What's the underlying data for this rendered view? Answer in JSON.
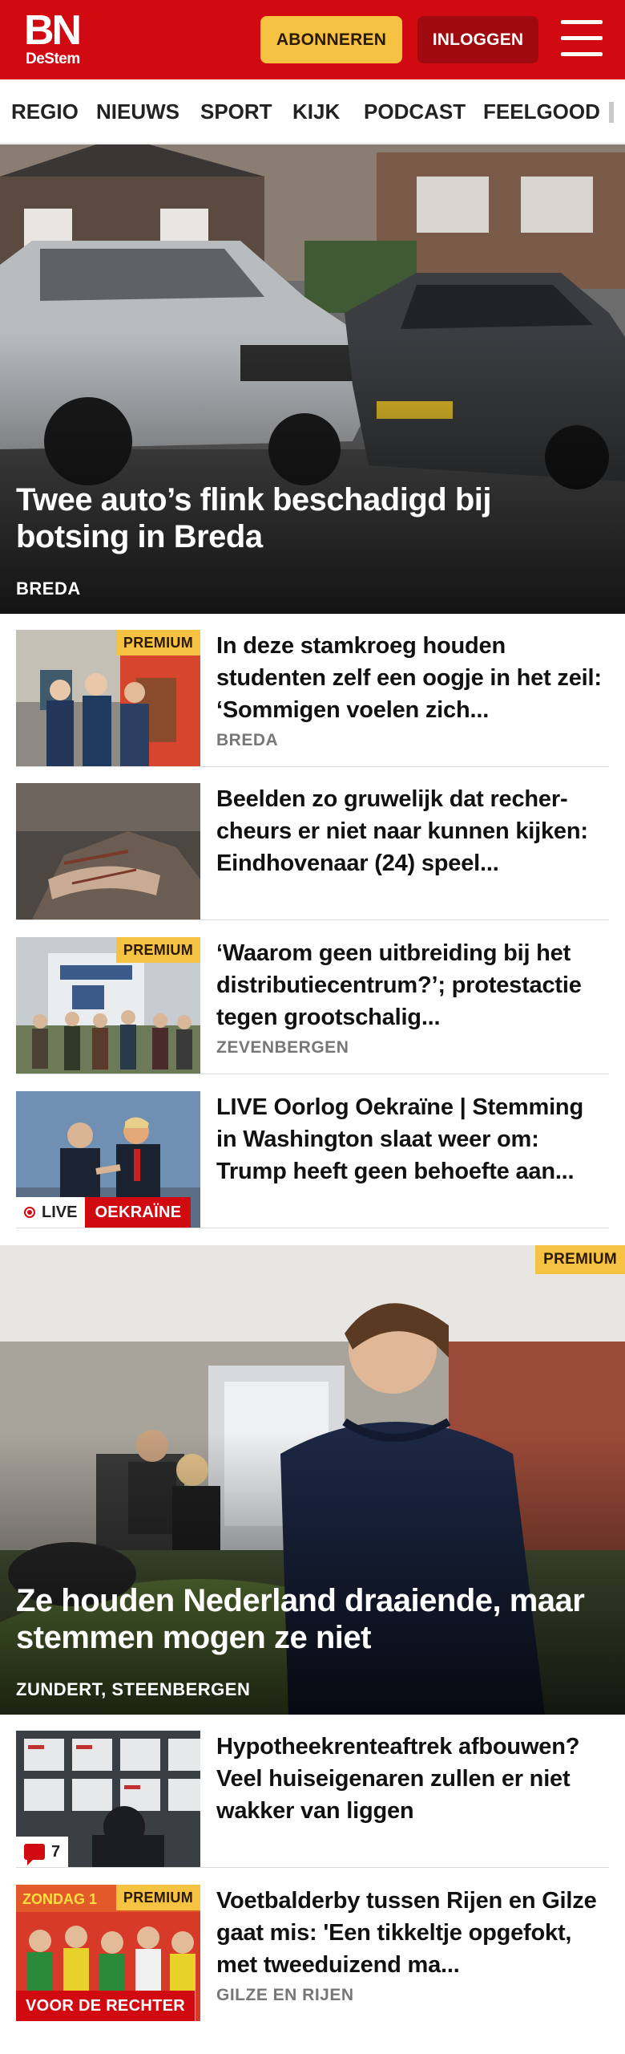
{
  "header": {
    "logo_main": "BN",
    "logo_sub": "DeStem",
    "subscribe_label": "ABONNEREN",
    "login_label": "INLOGGEN",
    "menu_icon": "hamburger-menu-icon",
    "brand_color": "#d10a11"
  },
  "nav": {
    "items": [
      "REGIO",
      "NIEUWS",
      "SPORT",
      "KIJK",
      "PODCAST",
      "FEELGOOD"
    ]
  },
  "hero1": {
    "title": "Twee auto’s flink beschadigd bij botsing in Breda",
    "location": "BREDA"
  },
  "articles": [
    {
      "title": "In deze stamkroeg houden studenten zelf een oogje in het zeil: ‘Sommigen voelen zich...",
      "location": "BREDA",
      "premium": "PREMIUM"
    },
    {
      "title": "Beelden zo gruwelijk dat recher­cheurs er niet naar kunnen kijken: Eindhovenaar (24) speel...",
      "location": ""
    },
    {
      "title": "‘Waarom geen uitbreiding bij het distributiecentrum?’; protestac­tie tegen grootschalig...",
      "location": "ZEVENBERGEN",
      "premium": "PREMIUM"
    },
    {
      "title": "LIVE Oorlog Oekraïne | Stemming in Washington slaat weer om: Trump heeft geen behoefte aan...",
      "location": "",
      "live_label": "LIVE",
      "tag": "OEKRAÏNE"
    }
  ],
  "hero2": {
    "title": "Ze houden Nederland draaiende, maar stemmen mogen ze niet",
    "location": "ZUNDERT, STEENBERGEN",
    "premium": "PREMIUM"
  },
  "articles2": [
    {
      "title": "Hypotheekrenteaftrek afbouwen? Veel huiseigenaren zullen er niet wakker van liggen",
      "comment_count": "7"
    },
    {
      "title": "Voetbalderby tussen Rijen en Gilze gaat mis: 'Een tikkeltje opgefokt, met tweeduizend ma...",
      "location": "GILZE EN RIJEN",
      "premium": "PREMIUM",
      "tag": "VOOR DE RECHTER",
      "image_text": "ZONDAG 1"
    }
  ]
}
